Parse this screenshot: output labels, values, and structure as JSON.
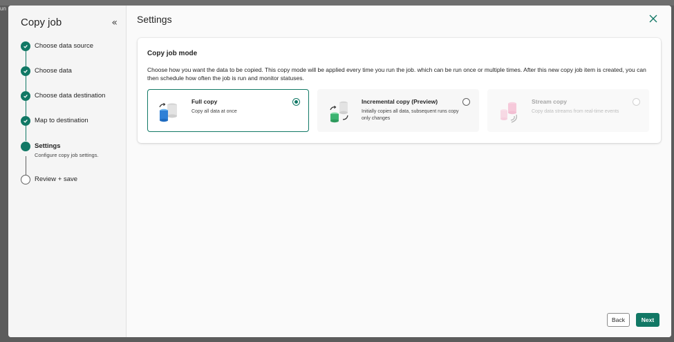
{
  "backdrop": {
    "fragment": "un"
  },
  "sidebar": {
    "title": "Copy job",
    "collapse_icon": "double-chevron-left-icon",
    "steps": [
      {
        "label": "Choose data source",
        "status": "done"
      },
      {
        "label": "Choose data",
        "status": "done"
      },
      {
        "label": "Choose data destination",
        "status": "done"
      },
      {
        "label": "Map to destination",
        "status": "done"
      },
      {
        "label": "Settings",
        "description": "Configure copy job settings.",
        "status": "current"
      },
      {
        "label": "Review + save",
        "status": "pending"
      }
    ]
  },
  "main": {
    "title": "Settings",
    "close_icon": "close-icon",
    "card": {
      "title": "Copy job mode",
      "description": "Choose how you want the data to be copied. This copy mode will be applied every time you run the job. which can be run once or multiple times. After this new copy job item is created, you can then schedule how often the job is run and monitor statuses.",
      "options": [
        {
          "title": "Full copy",
          "description": "Copy all data at once",
          "selected": true,
          "disabled": false
        },
        {
          "title": "Incremental copy (Preview)",
          "description": "Initially copies all data, subsequent runs copy only changes",
          "selected": false,
          "disabled": false
        },
        {
          "title": "Stream copy",
          "description": "Copy data streams from real-time events",
          "selected": false,
          "disabled": true
        }
      ]
    }
  },
  "footer": {
    "back_label": "Back",
    "next_label": "Next"
  },
  "colors": {
    "accent": "#117865",
    "sidebar_bg": "#f5f5f5",
    "main_bg": "#fafafa"
  }
}
